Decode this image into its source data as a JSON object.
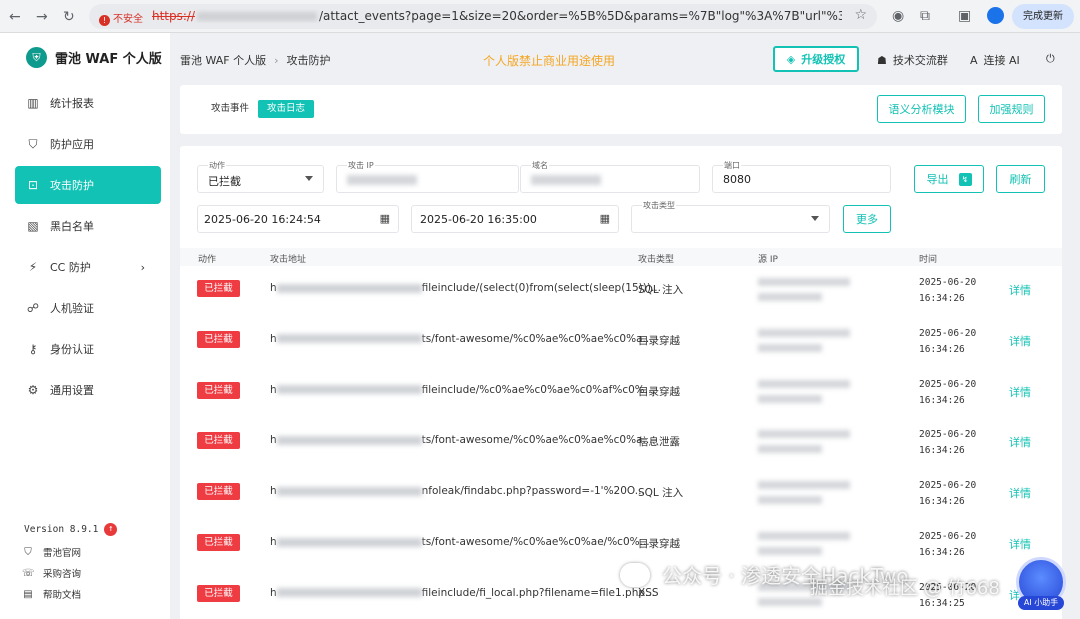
{
  "browser": {
    "insecure_label": "不安全",
    "url_scheme": "https://",
    "url_path": "/attact_events?page=1&size=20&order=%5B%5D&params=%7B\"log\"%3A%7B\"url\"%3A\"\"%2C\"attackType...",
    "update_label": "完成更新"
  },
  "app": {
    "name": "雷池 WAF 个人版",
    "logo_glyph": "⛨"
  },
  "sidebar": {
    "items": [
      {
        "label": "统计报表",
        "icon": "▥"
      },
      {
        "label": "防护应用",
        "icon": "⛉"
      },
      {
        "label": "攻击防护",
        "icon": "⊡"
      },
      {
        "label": "黑白名单",
        "icon": "▧"
      },
      {
        "label": "CC 防护",
        "icon": "⚡",
        "caret": "›"
      },
      {
        "label": "人机验证",
        "icon": "☍"
      },
      {
        "label": "身份认证",
        "icon": "⚷"
      },
      {
        "label": "通用设置",
        "icon": "⚙"
      }
    ],
    "version": "Version 8.9.1",
    "version_badge": "↑",
    "links": [
      {
        "label": "雷池官网",
        "icon": "⛉"
      },
      {
        "label": "采购咨询",
        "icon": "☏"
      },
      {
        "label": "帮助文档",
        "icon": "▤"
      }
    ]
  },
  "topbar": {
    "breadcrumb_root": "雷池 WAF 个人版",
    "breadcrumb_sep": "›",
    "breadcrumb_current": "攻击防护",
    "notice": "个人版禁止商业用途使用",
    "upgrade_label": "升级授权",
    "upgrade_icon": "◈",
    "community_label": "技术交流群",
    "community_icon": "☗",
    "ai_label": "连接 AI",
    "ai_icon": "A",
    "logout_icon": "⏻"
  },
  "tabs": {
    "items": [
      "攻击事件",
      "攻击日志"
    ],
    "active": "攻击日志",
    "semantic_btn": "语义分析模块",
    "rules_btn": "加强规则"
  },
  "filters": {
    "action_label": "动作",
    "action_value": "已拦截",
    "ip_label": "攻击 IP",
    "domain_label": "域名",
    "port_label": "端口",
    "port_value": "8080",
    "start_time": "2025-06-20 16:24:54",
    "end_time": "2025-06-20 16:35:00",
    "type_label": "攻击类型",
    "more_btn": "更多",
    "export_btn": "导出",
    "export_icon": "↯",
    "refresh_btn": "刷新",
    "calendar_icon": "▦"
  },
  "table": {
    "headers": [
      "动作",
      "攻击地址",
      "攻击类型",
      "源 IP",
      "时间"
    ],
    "rows": [
      {
        "action": "已拦截",
        "addr_prefix": "h",
        "addr": "fileinclude/(select(0)from(select(sleep(15)))...",
        "mask": 145,
        "type": "SQL 注入",
        "date": "2025-06-20",
        "time": "16:34:26",
        "detail": "详情"
      },
      {
        "action": "已拦截",
        "addr_prefix": "h",
        "addr": "ts/font-awesome/%c0%ae%c0%ae%c0%a...",
        "mask": 145,
        "type": "目录穿越",
        "date": "2025-06-20",
        "time": "16:34:26",
        "detail": "详情"
      },
      {
        "action": "已拦截",
        "addr_prefix": "h",
        "addr": "fileinclude/%c0%ae%c0%ae%c0%af%c0%...",
        "mask": 145,
        "type": "目录穿越",
        "date": "2025-06-20",
        "time": "16:34:26",
        "detail": "详情"
      },
      {
        "action": "已拦截",
        "addr_prefix": "h",
        "addr": "ts/font-awesome/%c0%ae%c0%ae%c0%a...",
        "mask": 145,
        "type": "信息泄露",
        "date": "2025-06-20",
        "time": "16:34:26",
        "detail": "详情"
      },
      {
        "action": "已拦截",
        "addr_prefix": "h",
        "addr": "nfoleak/findabc.php?password=-1'%20O...",
        "mask": 145,
        "type": "SQL 注入",
        "date": "2025-06-20",
        "time": "16:34:26",
        "detail": "详情"
      },
      {
        "action": "已拦截",
        "addr_prefix": "h",
        "addr": "ts/font-awesome/%c0%ae%c0%ae/%c0%...",
        "mask": 145,
        "type": "目录穿越",
        "date": "2025-06-20",
        "time": "16:34:26",
        "detail": "详情"
      },
      {
        "action": "已拦截",
        "addr_prefix": "h",
        "addr": "fileinclude/fi_local.php?filename=file1.php...",
        "mask": 145,
        "type": "XSS",
        "date": "2025-06-20",
        "time": "16:34:25",
        "detail": "详情"
      }
    ]
  },
  "overlay": {
    "watermark": "公众号 · 渗透安全HackTwo",
    "watermark2": "掘金技术社区 @ 竹668",
    "ai_helper": "AI 小助手"
  },
  "colors": {
    "accent": "#12c2b4",
    "danger": "#ef3b42",
    "notice": "#f5a623"
  }
}
